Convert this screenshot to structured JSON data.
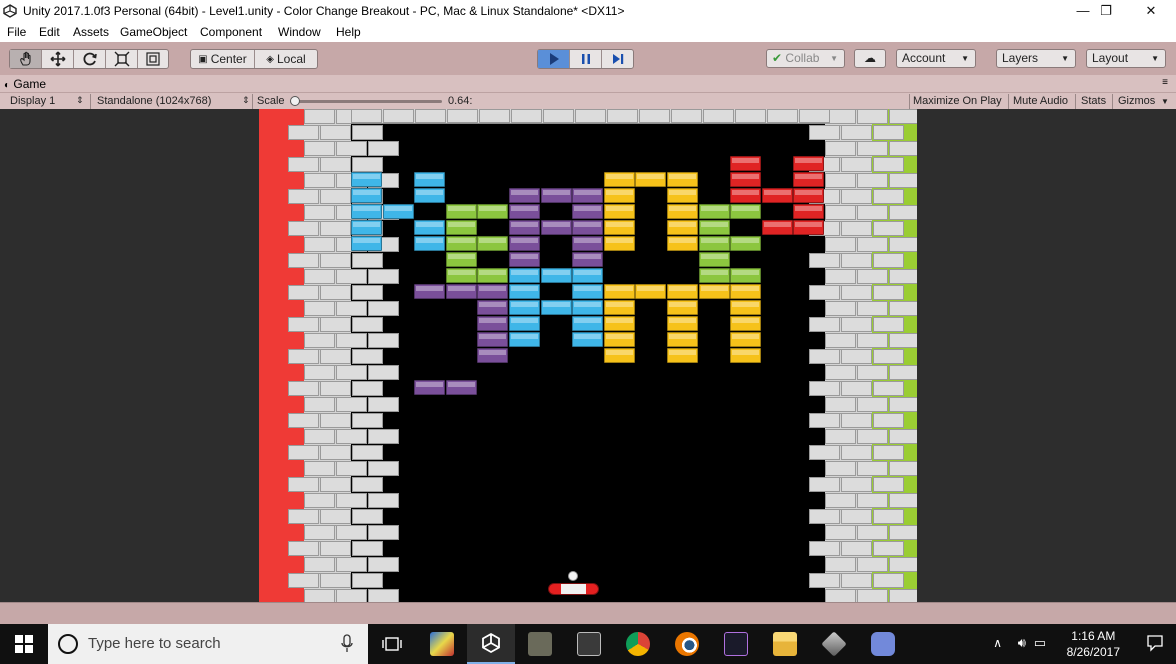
{
  "window": {
    "title": "Unity 2017.1.0f3 Personal (64bit) - Level1.unity - Color Change Breakout - PC, Mac & Linux Standalone* <DX11>",
    "minimize_glyph": "—",
    "restore_glyph": "❐",
    "close_glyph": "✕"
  },
  "menu": [
    "File",
    "Edit",
    "Assets",
    "GameObject",
    "Component",
    "Window",
    "Help"
  ],
  "toolbar": {
    "tools": [
      "hand-tool-icon",
      "move-tool-icon",
      "rotate-tool-icon",
      "scale-tool-icon",
      "rect-tool-icon"
    ],
    "pivot_label": "Center",
    "space_label": "Local",
    "play_state": "playing",
    "collab_label": "Collab",
    "account_label": "Account",
    "layers_label": "Layers",
    "layout_label": "Layout"
  },
  "game_tab": {
    "label": "Game"
  },
  "game_bar": {
    "display_label": "Display 1",
    "resolution_label": "Standalone (1024x768)",
    "scale_label": "Scale",
    "scale_value": "0.64:",
    "scale_level": 0.0,
    "maximize_label": "Maximize On Play",
    "mute_label": "Mute Audio",
    "stats_label": "Stats",
    "gizmos_label": "Gizmos"
  },
  "colors": {
    "cyan": "#3fb6e8",
    "green": "#8cc63f",
    "purple": "#7a4f9a",
    "yellow": "#f6c21a",
    "red": "#e02424",
    "left_wall": "#ef3a36",
    "right_wall": "#9acd33"
  },
  "taskbar": {
    "search_placeholder": "Type here to search",
    "time": "1:16 AM",
    "date": "8/26/2017"
  }
}
